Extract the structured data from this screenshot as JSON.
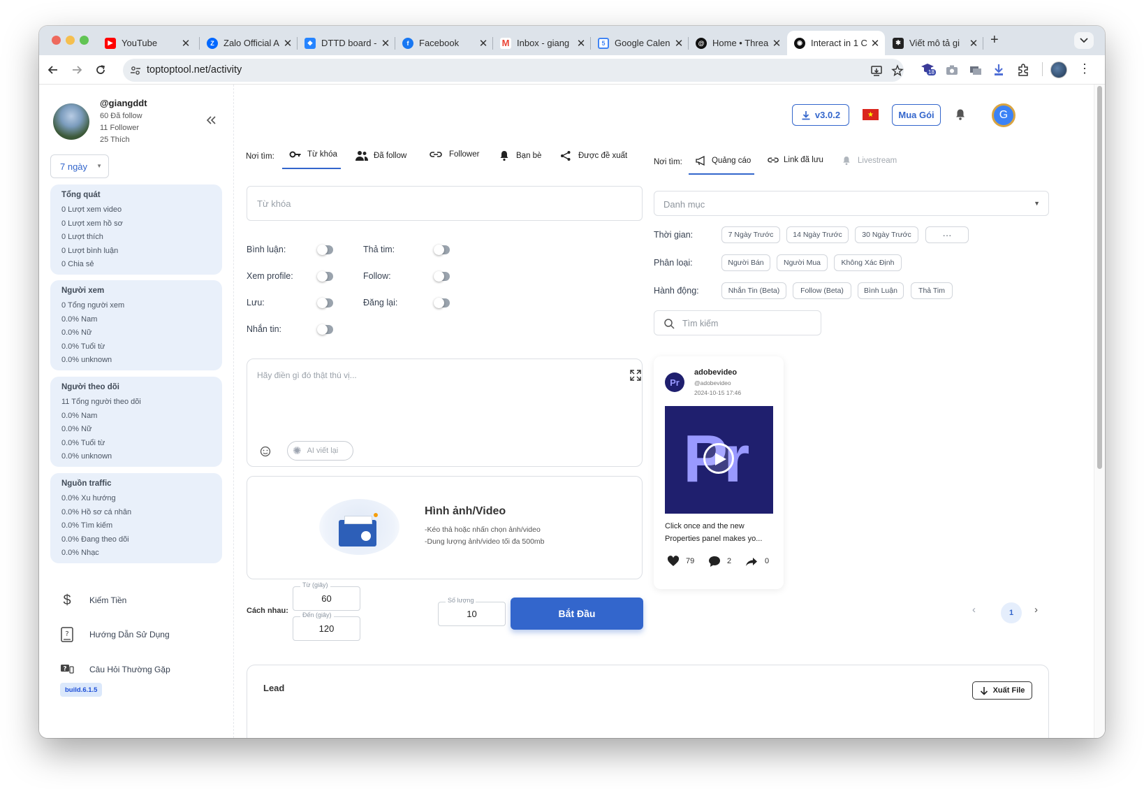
{
  "browser": {
    "tabs": [
      {
        "title": "YouTube",
        "favicon": "youtube-icon"
      },
      {
        "title": "Zalo Official A",
        "favicon": "zalo-icon"
      },
      {
        "title": "DTTD board -",
        "favicon": "jira-icon"
      },
      {
        "title": "Facebook",
        "favicon": "facebook-icon"
      },
      {
        "title": "Inbox - giang",
        "favicon": "gmail-icon"
      },
      {
        "title": "Google Calen",
        "favicon": "calendar-icon"
      },
      {
        "title": "Home • Threa",
        "favicon": "threads-icon"
      },
      {
        "title": "Interact in 1 C",
        "favicon": "app-icon",
        "active": true
      },
      {
        "title": "Viết mô tả gi",
        "favicon": "ai-icon"
      }
    ],
    "url": "toptoptool.net/activity",
    "extension_badge": "18"
  },
  "profile": {
    "username": "@giangddt",
    "following": "60 Đã follow",
    "followers": "11 Follower",
    "likes": "25 Thích"
  },
  "period_select": "7 ngày",
  "stat_cards": [
    {
      "title": "Tổng quát",
      "rows": [
        "0 Lượt xem video",
        "0 Lượt xem hồ sơ",
        "0 Lượt thích",
        "0 Lượt bình luận",
        "0 Chia sẻ"
      ]
    },
    {
      "title": "Người xem",
      "rows": [
        "0 Tổng người xem",
        "0.0% Nam",
        "0.0% Nữ",
        "0.0% Tuổi từ",
        "0.0% unknown"
      ]
    },
    {
      "title": "Người theo dõi",
      "rows": [
        "11 Tổng người theo dõi",
        "0.0% Nam",
        "0.0% Nữ",
        "0.0% Tuổi từ",
        "0.0% unknown"
      ]
    },
    {
      "title": "Nguồn traffic",
      "rows": [
        "0.0% Xu hướng",
        "0.0% Hồ sơ cá nhân",
        "0.0% Tìm kiếm",
        "0.0% Đang theo dõi",
        "0.0% Nhạc"
      ]
    }
  ],
  "nav": {
    "earn": "Kiếm Tiền",
    "guide": "Hướng Dẫn Sử Dụng",
    "faq": "Câu Hỏi Thường Gặp",
    "build": "build.6.1.5"
  },
  "header": {
    "version": "v3.0.2",
    "buy_label": "Mua Gói",
    "avatar_letter": "G"
  },
  "left_panel": {
    "search_in_label": "Nơi tìm:",
    "tabs": [
      "Từ khóa",
      "Đã follow",
      "Follower",
      "Bạn bè",
      "Được đề xuất"
    ],
    "keyword_placeholder": "Từ khóa",
    "toggles": {
      "comment": "Bình luận:",
      "heart": "Thả tim:",
      "view_profile": "Xem profile:",
      "follow": "Follow:",
      "save": "Lưu:",
      "repost": "Đăng lại:",
      "message": "Nhắn tin:"
    },
    "message_placeholder": "Hãy điền gì đó thật thú vị...",
    "ai_rewrite": "AI viết lại",
    "upload": {
      "title": "Hình ảnh/Video",
      "line1": "-Kéo thả hoặc nhấn chọn ảnh/video",
      "line2": "-Dung lượng ảnh/video tối đa 500mb"
    },
    "interval_label": "Cách nhau:",
    "from_label": "Từ (giây)",
    "from_value": "60",
    "to_label": "Đến (giây)",
    "to_value": "120",
    "quantity_label": "Số lượng",
    "quantity_value": "10",
    "start_button": "Bắt Đầu"
  },
  "right_panel": {
    "search_in_label": "Nơi tìm:",
    "tabs": [
      "Quảng cáo",
      "Link đã lưu",
      "Livestream"
    ],
    "category_placeholder": "Danh mục",
    "time_label": "Thời gian:",
    "time_chips": [
      "7 Ngày Trước",
      "14 Ngày Trước",
      "30 Ngày Trước",
      "···"
    ],
    "type_label": "Phân loại:",
    "type_chips": [
      "Người Bán",
      "Người Mua",
      "Không Xác Định"
    ],
    "action_label": "Hành động:",
    "action_chips": [
      "Nhắn Tin (Beta)",
      "Follow (Beta)",
      "Bình Luận",
      "Thả Tim"
    ],
    "search_placeholder": "Tìm kiếm",
    "post": {
      "author": "adobevideo",
      "handle": "@adobevideo",
      "date": "2024-10-15 17:46",
      "caption_line1": "Click once and the new",
      "caption_line2": "Properties panel makes yo...",
      "likes": "79",
      "comments": "2",
      "shares": "0"
    },
    "page": "1"
  },
  "lead": {
    "title": "Lead",
    "export_button": "Xuất File"
  },
  "colors": {
    "primary": "#3366cc",
    "accent_blue": "#2563eb",
    "card_bg": "#e9f0fa",
    "premiere_bg": "#1f1f6e",
    "premiere_fg": "#9999ff"
  }
}
